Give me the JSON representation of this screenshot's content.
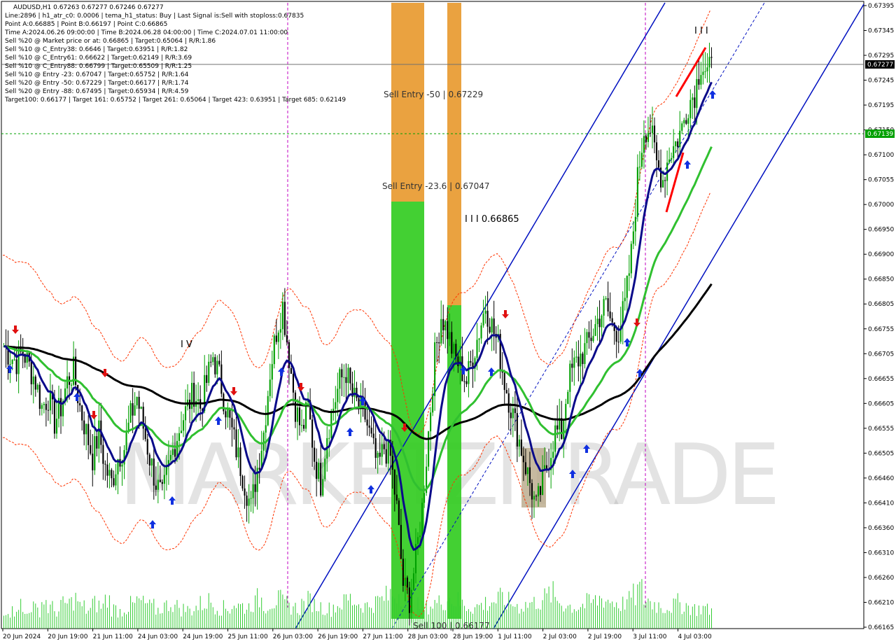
{
  "header": {
    "lines": [
      "AUDUSD,H1  0.67263 0.67277 0.67246 0.67277",
      "Line:2896 | h1_atr_c0: 0.0006 | tema_h1_status: Buy | Last Signal is:Sell with stoploss:0.67835",
      "Point A:0.66885 | Point B:0.66197 | Point C:0.66865",
      "Time A:2024.06.26 09:00:00 | Time B:2024.06.28 04:00:00 | Time C:2024.07.01 11:00:00",
      "Sell %20 @ Market price or at: 0.66865 | Target:0.65064 | R/R:1.86",
      "Sell %10 @ C_Entry38: 0.6646 | Target:0.63951 | R/R:1.82",
      "Sell %10 @ C_Entry61: 0.66622 | Target:0.62149 | R/R:3.69",
      "Sell %10 @ C_Entry88: 0.66799 | Target:0.65509 | R/R:1.25",
      "Sell %10 @ Entry -23: 0.67047 | Target:0.65752 | R/R:1.64",
      "Sell %20 @ Entry -50: 0.67229 | Target:0.66177 | R/R:1.74",
      "Sell %20 @ Entry -88: 0.67495 | Target:0.65934 | R/R:4.59",
      "Target100: 0.66177 | Target 161: 0.65752 | Target 261: 0.65064 | Target 423: 0.63951 | Target 685: 0.62149"
    ]
  },
  "zone_labels": {
    "entry_50": "Sell Entry -50 | 0.67229",
    "entry_236": "Sell Entry -23.6 | 0.67047",
    "point_c": "I I I 0.66865",
    "sell100": "Sell 100 | 0.66177",
    "wave_iv": "I V",
    "wave_iii_top": "I I I"
  },
  "watermark": "MARKETZITRADE",
  "current_price": "0.67277",
  "level_price": "0.67139",
  "chart_data": {
    "type": "candlestick",
    "symbol": "AUDUSD",
    "timeframe": "H1",
    "ylim": [
      0.66165,
      0.67395
    ],
    "price_ticks": [
      "0.67395",
      "0.67345",
      "0.67295",
      "0.67245",
      "0.67195",
      "0.67150",
      "0.67100",
      "0.67055",
      "0.67000",
      "0.66950",
      "0.66900",
      "0.66850",
      "0.66805",
      "0.66755",
      "0.66705",
      "0.66655",
      "0.66605",
      "0.66555",
      "0.66505",
      "0.66460",
      "0.66410",
      "0.66360",
      "0.66310",
      "0.66260",
      "0.66210",
      "0.66165"
    ],
    "date_ticks": [
      "20 Jun 2024",
      "20 Jun 19:00",
      "21 Jun 11:00",
      "24 Jun 03:00",
      "24 Jun 19:00",
      "25 Jun 11:00",
      "26 Jun 03:00",
      "26 Jun 19:00",
      "27 Jun 11:00",
      "28 Jun 03:00",
      "28 Jun 19:00",
      "1 Jul 11:00",
      "2 Jul 03:00",
      "2 Jul 19:00",
      "3 Jul 11:00",
      "4 Jul 03:00"
    ],
    "close_path": [
      0.6672,
      0.667,
      0.6669,
      0.6671,
      0.6668,
      0.6665,
      0.666,
      0.6662,
      0.6657,
      0.666,
      0.6665,
      0.6667,
      0.666,
      0.6655,
      0.665,
      0.6655,
      0.6648,
      0.6645,
      0.665,
      0.6652,
      0.6658,
      0.6662,
      0.6656,
      0.665,
      0.6645,
      0.6642,
      0.6648,
      0.6653,
      0.6657,
      0.666,
      0.6663,
      0.666,
      0.6665,
      0.667,
      0.6666,
      0.666,
      0.6655,
      0.665,
      0.6645,
      0.664,
      0.6648,
      0.6655,
      0.6667,
      0.6675,
      0.668,
      0.667,
      0.666,
      0.6655,
      0.666,
      0.665,
      0.6645,
      0.6655,
      0.666,
      0.6665,
      0.6667,
      0.6662,
      0.666,
      0.6658,
      0.6653,
      0.6648,
      0.6652,
      0.665,
      0.664,
      0.6625,
      0.6622,
      0.663,
      0.664,
      0.6655,
      0.667,
      0.6678,
      0.6675,
      0.667,
      0.6668,
      0.6665,
      0.667,
      0.6675,
      0.668,
      0.6676,
      0.6672,
      0.6665,
      0.666,
      0.6655,
      0.665,
      0.6645,
      0.664,
      0.6645,
      0.665,
      0.6655,
      0.6655,
      0.6665,
      0.6668,
      0.667,
      0.6672,
      0.6675,
      0.6678,
      0.668,
      0.6676,
      0.6675,
      0.668,
      0.669,
      0.6705,
      0.6715,
      0.6715,
      0.6708,
      0.6705,
      0.671,
      0.6712,
      0.6715,
      0.672,
      0.6722,
      0.6728,
      0.6726,
      0.6727
    ],
    "volume": [
      40,
      35,
      50,
      30,
      45,
      38,
      55,
      42,
      36,
      48,
      52,
      60,
      44,
      38,
      50,
      46,
      58,
      40,
      36,
      42,
      48,
      55,
      50,
      44,
      38,
      46,
      52,
      45,
      40,
      38,
      44,
      50,
      56,
      48,
      42,
      40,
      50,
      46,
      44,
      52,
      60,
      48,
      55,
      58,
      50,
      46,
      42,
      50,
      56,
      48,
      44,
      40,
      46,
      52,
      60,
      56,
      50,
      46,
      52,
      58,
      64,
      70,
      74,
      60,
      50,
      46,
      42,
      48,
      52,
      58,
      62,
      56,
      50,
      46,
      44,
      48,
      52,
      56,
      60,
      54,
      50,
      46,
      48,
      52,
      56,
      62,
      70,
      58,
      50,
      46,
      44,
      48,
      52,
      56,
      62,
      58,
      54,
      50,
      56,
      66,
      78,
      60,
      52,
      48,
      44,
      46,
      52,
      48,
      44,
      40,
      42,
      38,
      36
    ]
  },
  "colors": {
    "bull": "#00a000",
    "bear": "#000000",
    "tema_blue": "#0a0a8a",
    "ma_green": "#30c030",
    "ma_black": "#000000",
    "channel": "#0010c0",
    "orange_zone": "#e89a30",
    "green_zone": "#33cc22",
    "tan_zone": "#b8a888",
    "stop_red": "#ff3300",
    "level_green": "#00a000",
    "arrow_up": "#1030e0",
    "arrow_down": "#e01010"
  }
}
